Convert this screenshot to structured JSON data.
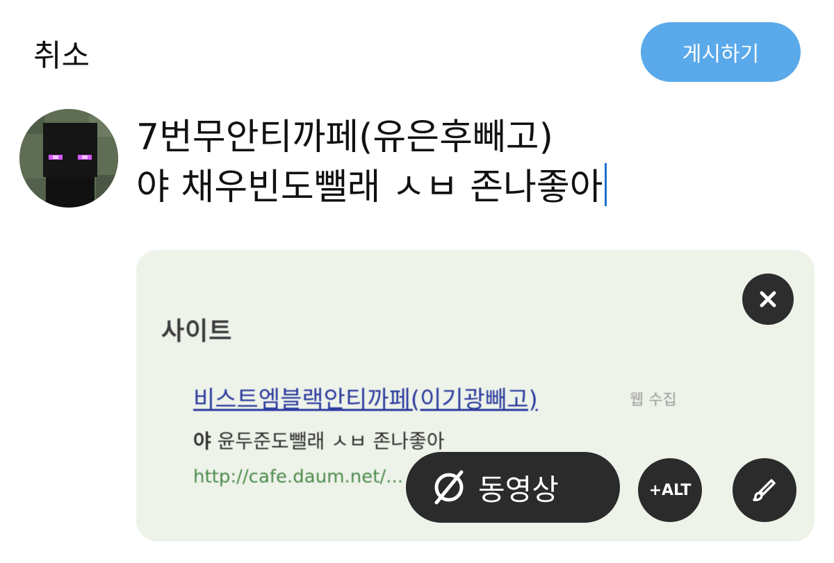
{
  "header": {
    "cancel_label": "취소",
    "post_label": "게시하기"
  },
  "composer": {
    "line1": "7번무안티까페(유은후빼고)",
    "line2": "야 채우빈도뺄래 ㅅㅂ 존나좋아"
  },
  "media": {
    "heading": "사이트",
    "link_text": "비스트엠블랙안티까페(이기광빼고)",
    "tag_text": "웹 수집",
    "desc_bold": "야",
    "desc_text": " 윤두준도뺄래 ㅅㅂ 존나좋아",
    "url_text": "http://cafe.daum.net/..."
  },
  "media_controls": {
    "video_label": "동영상",
    "alt_label": "+ALT"
  },
  "colors": {
    "post_button": "#5aa9ea",
    "caret": "#1d6ec7",
    "control_bg": "#2b2b2b"
  }
}
